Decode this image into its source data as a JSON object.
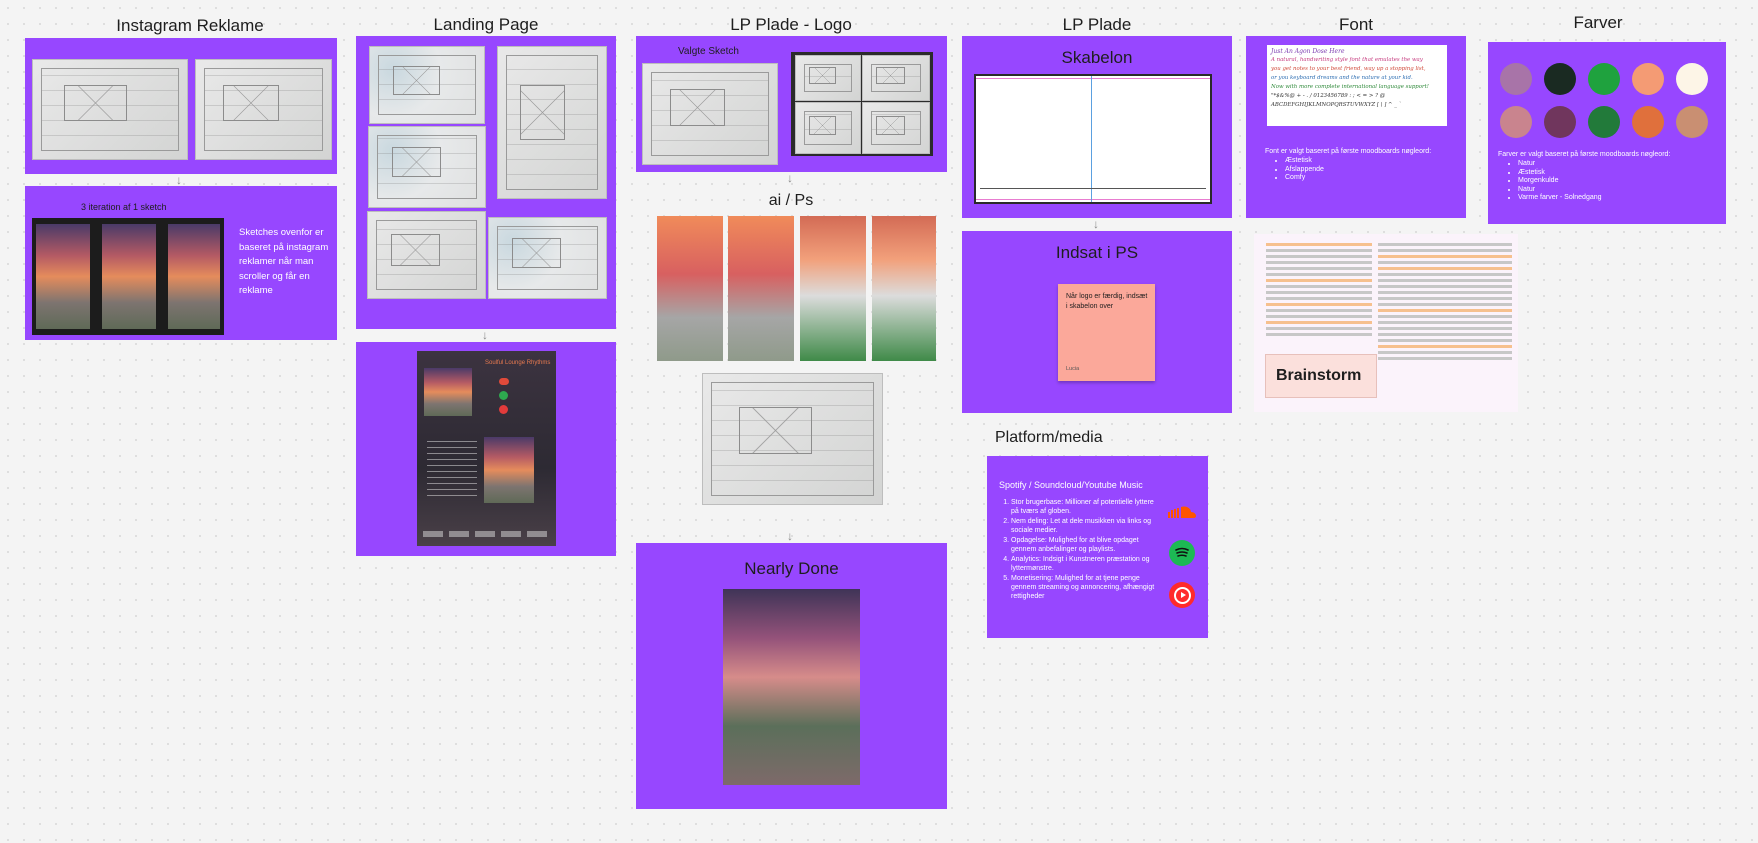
{
  "columns": {
    "instagram": "Instagram Reklame",
    "landing": "Landing Page",
    "lp_logo": "LP Plade - Logo",
    "lp_plade": "LP  Plade",
    "font": "Font",
    "farver": "Farver"
  },
  "instagram": {
    "iteration_title": "3 iteration af 1 sketch",
    "description": "Sketches ovenfor er baseret på instagram reklamer når man scroller og får en reklame"
  },
  "lp_logo": {
    "valgte_sketch": "Valgte Sketch",
    "ai_ps": "ai / Ps",
    "nearly_done": "Nearly Done"
  },
  "lp_plade": {
    "skabelon": "Skabelon",
    "indsat": "Indsat i PS",
    "sticky_text": "Når logo er færdig, indsæt i skabelon over",
    "sticky_author": "Lucia",
    "platform_title": "Platform/media",
    "platform_heading": "Spotify / Soundcloud/Youtube Music",
    "platform_points": [
      "Stor brugerbase: Millioner af potentielle lyttere på tværs af globen.",
      "Nem deling: Let at dele musikken via links og sociale medier.",
      "Opdagelse: Mulighed for at blive opdaget gennem anbefalinger og playlists.",
      "Analytics: Indsigt i Kunstneren præstation og lyttermønstre.",
      "Monetisering: Mulighed for at tjene penge gennem streaming og annoncering, afhængigt rettigheder"
    ]
  },
  "font": {
    "sample_lines": [
      "Just An Agon Dose Here",
      "A natural, handwriting style font that emulates the way",
      "you get notes to your best friend, way up a stopping list,",
      "or you keyboard dreams and the nature at your kid.",
      "Now with more complete international language support!",
      "\"*$&%@ + - . / 0123456789 : ; < = > ? @",
      "ABCDEFGHIJKLMNOPQRSTUVWXYZ [ \\ ] ^ _ `"
    ],
    "description": "Font er valgt baseret på første moodboards nøgleord:",
    "keywords": [
      "Æstetisk",
      "Afslappende",
      "Comfy"
    ]
  },
  "farver": {
    "colors": [
      "#a874a8",
      "#1a2a22",
      "#1fa23e",
      "#f49b74",
      "#fdf5e7",
      "#c9848e",
      "#70365d",
      "#227a3a",
      "#e0703c",
      "#c98f72"
    ],
    "description": "Farver er valgt baseret på første moodboards nøgleord:",
    "keywords": [
      "Natur",
      "Æstetisk",
      "Morgenkulde",
      "Natur",
      "Varme farver - Solnedgang"
    ]
  },
  "brainstorm": {
    "title": "Brainstorm"
  },
  "landing": {
    "mock_title": "Soulful Lounge Rhythms"
  }
}
